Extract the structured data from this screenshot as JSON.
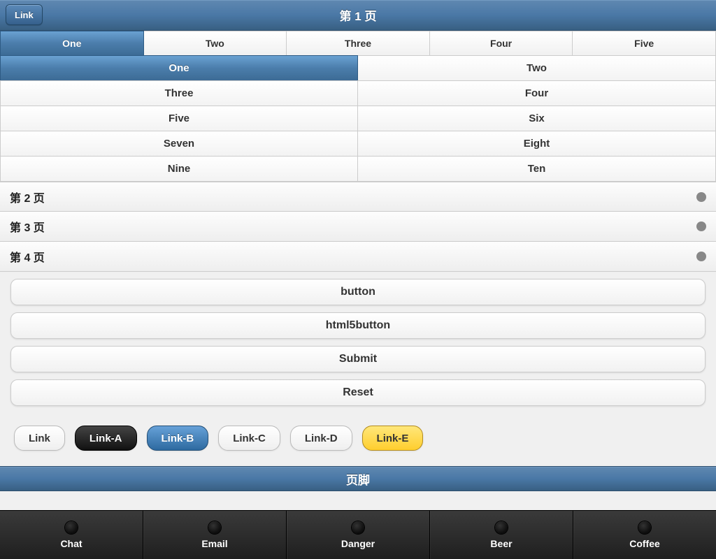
{
  "header": {
    "title": "第 1 页",
    "link_btn": "Link"
  },
  "segments": [
    {
      "label": "One",
      "active": true
    },
    {
      "label": "Two",
      "active": false
    },
    {
      "label": "Three",
      "active": false
    },
    {
      "label": "Four",
      "active": false
    },
    {
      "label": "Five",
      "active": false
    }
  ],
  "grid": [
    {
      "label": "One",
      "active": true
    },
    {
      "label": "Two",
      "active": false
    },
    {
      "label": "Three",
      "active": false
    },
    {
      "label": "Four",
      "active": false
    },
    {
      "label": "Five",
      "active": false
    },
    {
      "label": "Six",
      "active": false
    },
    {
      "label": "Seven",
      "active": false
    },
    {
      "label": "Eight",
      "active": false
    },
    {
      "label": "Nine",
      "active": false
    },
    {
      "label": "Ten",
      "active": false
    }
  ],
  "list": [
    {
      "label": "第 2 页"
    },
    {
      "label": "第 3 页"
    },
    {
      "label": "第 4 页"
    }
  ],
  "big_buttons": {
    "button": "button",
    "html5button": "html5button",
    "submit": "Submit",
    "reset": "Reset"
  },
  "pills": {
    "link": "Link",
    "link_a": "Link-A",
    "link_b": "Link-B",
    "link_c": "Link-C",
    "link_d": "Link-D",
    "link_e": "Link-E"
  },
  "footer_title": "页脚",
  "tabs": [
    {
      "label": "Chat"
    },
    {
      "label": "Email"
    },
    {
      "label": "Danger"
    },
    {
      "label": "Beer"
    },
    {
      "label": "Coffee"
    }
  ]
}
